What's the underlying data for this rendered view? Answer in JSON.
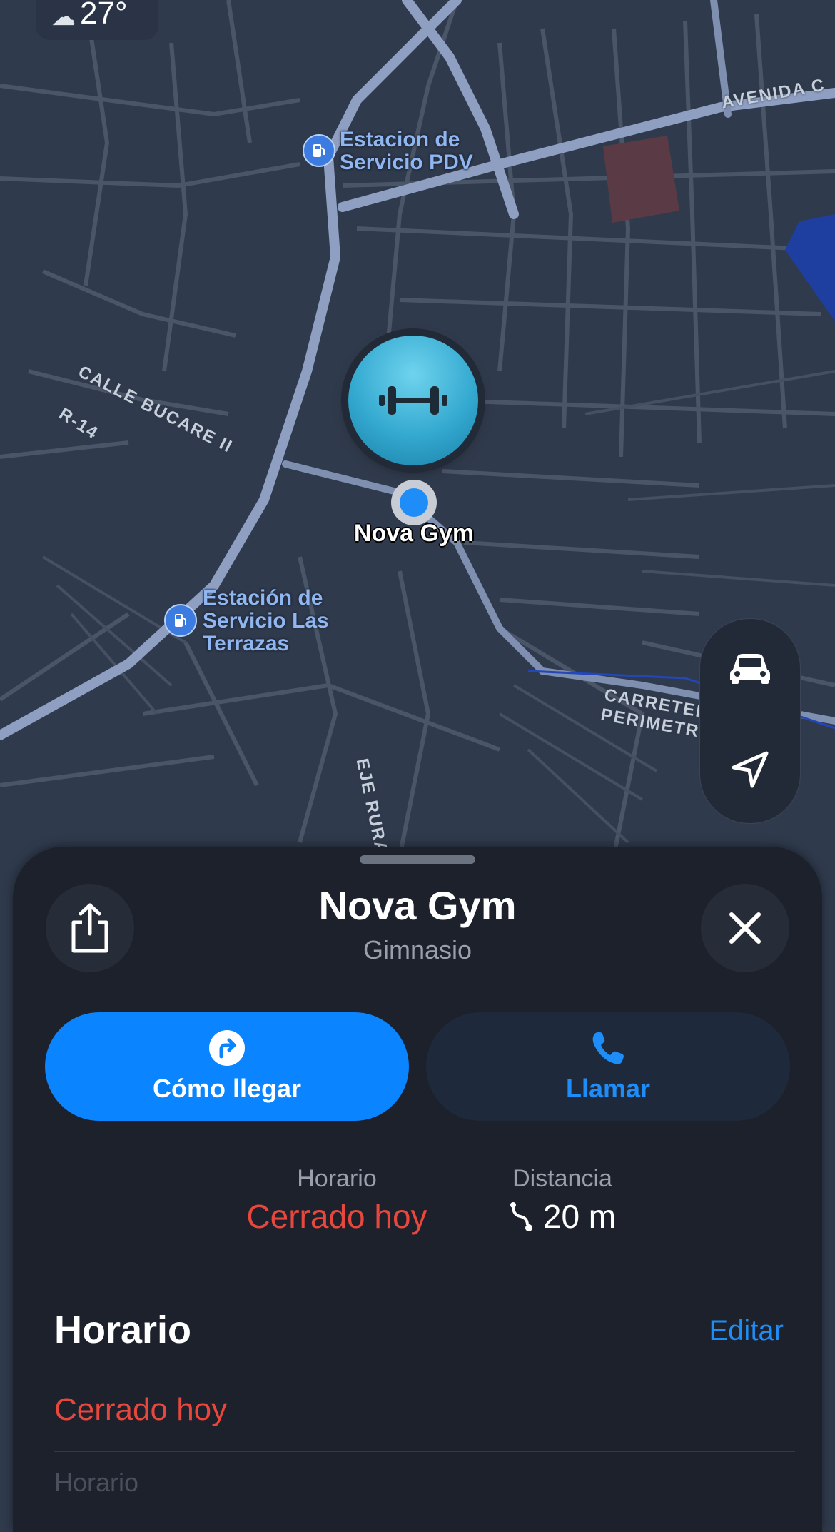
{
  "weather": {
    "temperature": "27°",
    "icon": "cloud-rain-icon"
  },
  "map": {
    "pois": [
      {
        "name_line1": "Estacion de",
        "name_line2": "Servicio PDV",
        "icon": "fuel-pump-icon"
      },
      {
        "name_line1": "Estación de",
        "name_line2": "Servicio Las",
        "name_line3": "Terrazas",
        "icon": "fuel-pump-icon"
      }
    ],
    "streets": [
      "AVENIDA C",
      "CALLE BUCARE II",
      "R-14",
      "EJE RURAL CARA",
      "CARRETERA PERIMETRAL"
    ],
    "selected_pin_label": "Nova Gym",
    "colors": {
      "background": "#2f3a4c",
      "road": "#4a5568",
      "major_road": "#8f9fc2",
      "water": "#1e3fa0"
    }
  },
  "controls": {
    "transport_icon": "car-icon",
    "location_icon": "location-arrow-icon"
  },
  "sheet": {
    "title": "Nova Gym",
    "subtitle": "Gimnasio",
    "share_icon": "share-icon",
    "close_icon": "close-icon",
    "actions": {
      "directions_label": "Cómo llegar",
      "directions_icon": "turn-right-icon",
      "call_label": "Llamar",
      "call_icon": "phone-icon"
    },
    "stats": {
      "hours_label": "Horario",
      "hours_value": "Cerrado hoy",
      "distance_label": "Distancia",
      "distance_value": "20 m",
      "distance_icon": "route-icon"
    },
    "hours_section": {
      "title": "Horario",
      "edit_label": "Editar",
      "today_status": "Cerrado hoy",
      "next_row_partial": "Horario"
    }
  },
  "colors": {
    "accent": "#0a84ff",
    "closed": "#e8473d",
    "sheet_bg": "#1c212c"
  }
}
